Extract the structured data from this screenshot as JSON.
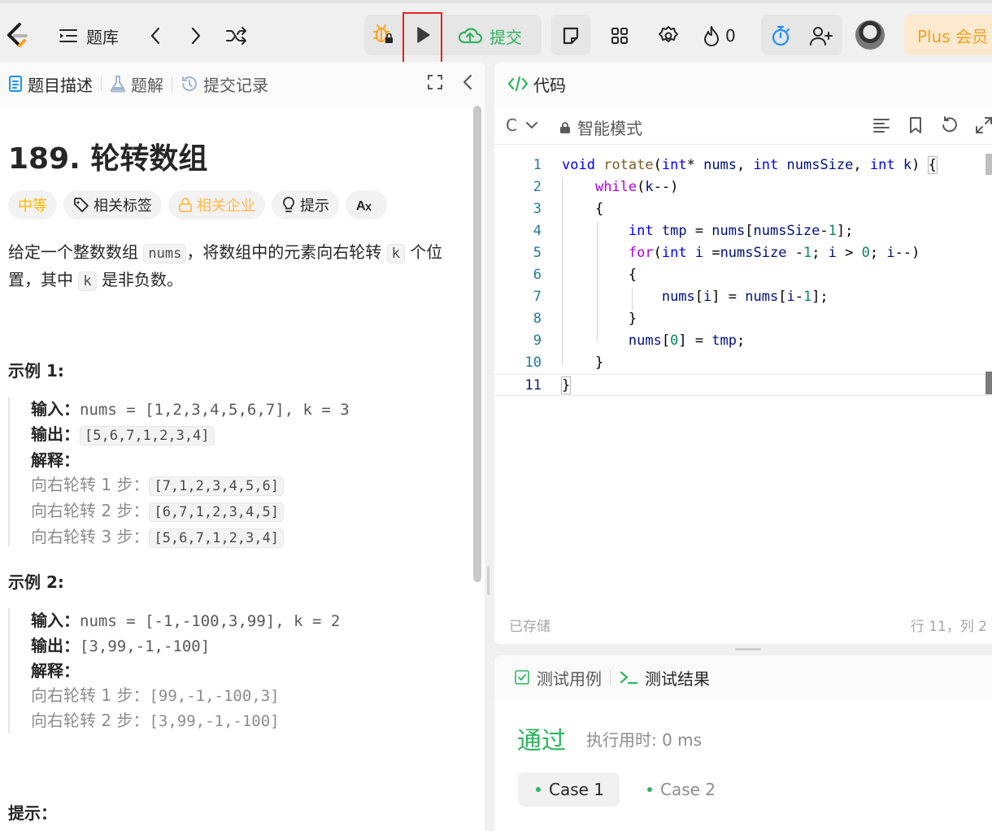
{
  "topbar": {
    "problem_list_label": "题库",
    "submit_label": "提交",
    "streak_count": "0",
    "plus_label": "Plus 会员"
  },
  "left": {
    "tabs": [
      {
        "label": "题目描述"
      },
      {
        "label": "题解"
      },
      {
        "label": "提交记录"
      }
    ],
    "title": "189. 轮转数组",
    "tags": {
      "difficulty": "中等",
      "related_tags": "相关标签",
      "companies": "相关企业",
      "hint": "提示"
    },
    "description": {
      "part1": "给定一个整数数组 ",
      "code1": "nums",
      "part2": "，将数组中的元素向右轮转 ",
      "code2": "k",
      "part3": " 个位置，其中 ",
      "code3": "k",
      "part4": " 是非负数。"
    },
    "example1": {
      "title": "示例 1:",
      "input_label": "输入：",
      "input_value": "nums = [1,2,3,4,5,6,7], k = 3",
      "output_label": "输出：",
      "output_value": "[5,6,7,1,2,3,4]",
      "explain_label": "解释：",
      "steps": [
        {
          "text": "向右轮转 1 步：",
          "value": "[7,1,2,3,4,5,6]"
        },
        {
          "text": "向右轮转 2 步：",
          "value": "[6,7,1,2,3,4,5]"
        },
        {
          "text": "向右轮转 3 步：",
          "value": "[5,6,7,1,2,3,4]"
        }
      ]
    },
    "example2": {
      "title": "示例 2:",
      "input_label": "输入：",
      "input_value": "nums = [-1,-100,3,99], k = 2",
      "output_label": "输出：",
      "output_value": "[3,99,-1,-100]",
      "explain_label": "解释：",
      "steps": [
        {
          "text": "向右轮转 1 步：",
          "value": "[99,-1,-100,3]"
        },
        {
          "text": "向右轮转 2 步：",
          "value": "[3,99,-1,-100]"
        }
      ]
    },
    "hints_title": "提示："
  },
  "editor": {
    "title": "代码",
    "language": "C",
    "mode": "智能模式",
    "line_numbers": [
      "1",
      "2",
      "3",
      "4",
      "5",
      "6",
      "7",
      "8",
      "9",
      "10",
      "11"
    ],
    "saved_status": "已存储",
    "cursor_position": "行 11，列 2"
  },
  "result": {
    "tabs": [
      {
        "label": "测试用例"
      },
      {
        "label": "测试结果"
      }
    ],
    "status": "通过",
    "runtime": "执行用时: 0 ms",
    "cases": [
      "Case 1",
      "Case 2"
    ]
  }
}
